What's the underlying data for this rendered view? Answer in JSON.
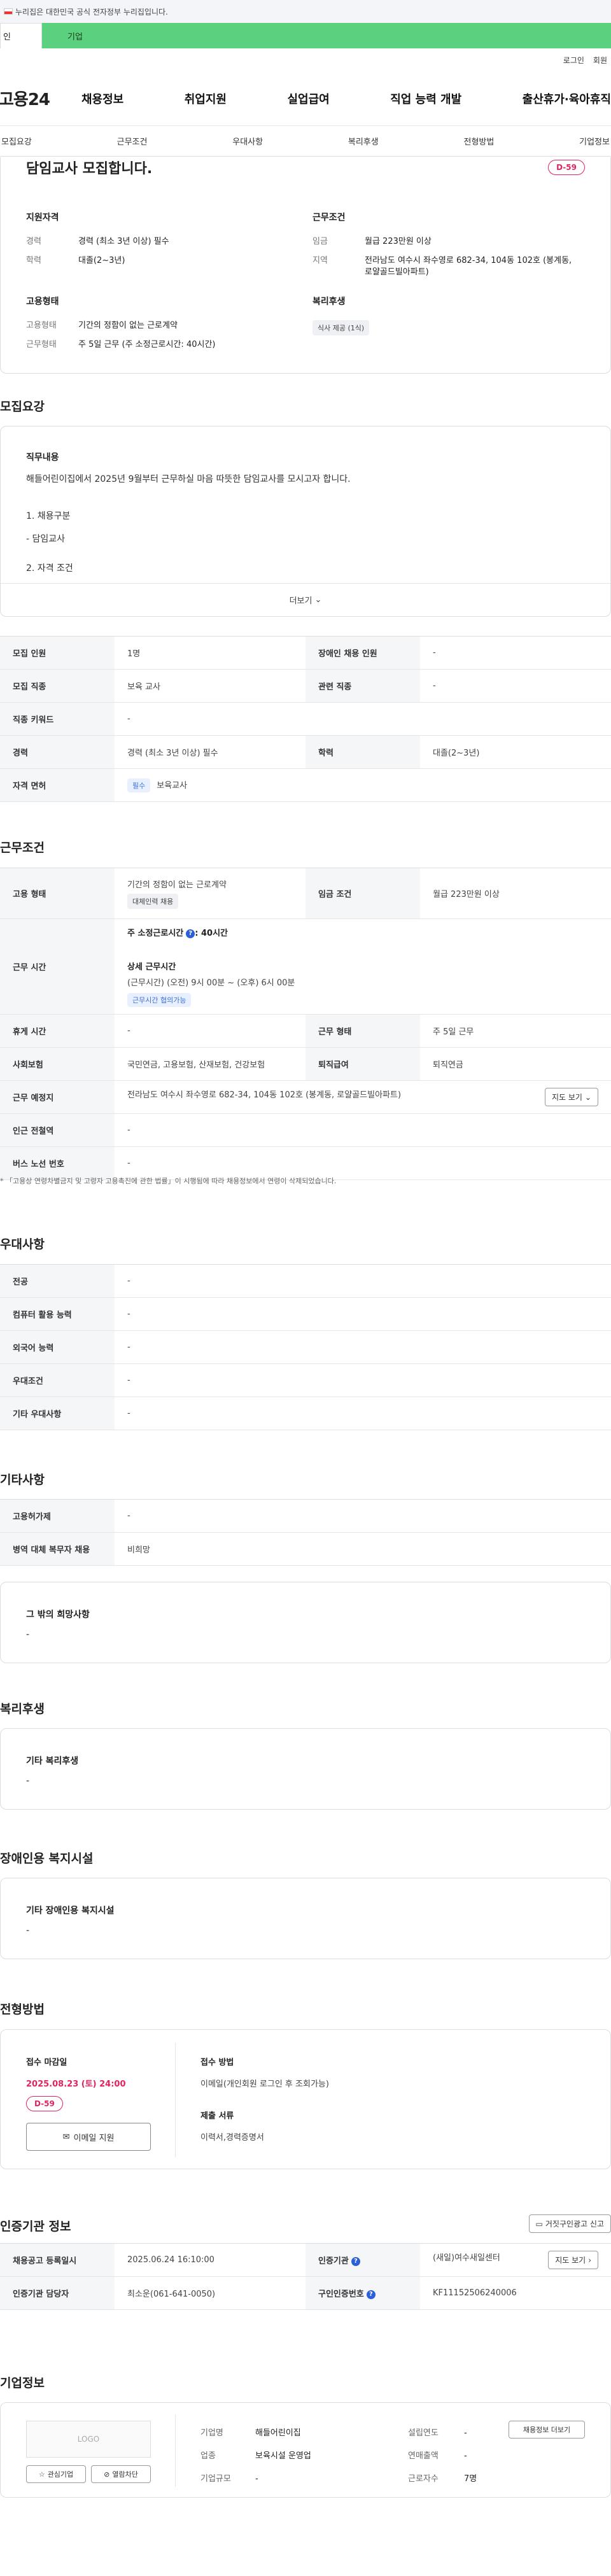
{
  "notice": {
    "text": "누리집은 대한민국 공식 전자정부 누리집입니다."
  },
  "tabs": {
    "personal": "인",
    "company": "기업"
  },
  "utility": {
    "login": "로그인",
    "join": "회원"
  },
  "gnb": {
    "logo": "고용24",
    "menu": [
      "채용정보",
      "취업지원",
      "실업급여",
      "직업 능력 개발",
      "출산휴가·육아휴직"
    ]
  },
  "subtabs": [
    "모집요강",
    "근무조건",
    "우대사항",
    "복리후생",
    "전형방법",
    "기업정보"
  ],
  "job": {
    "title": "담임교사 모집합니다.",
    "dday": "D-59",
    "support": {
      "heading": "지원자격",
      "rows": [
        {
          "k": "경력",
          "v": "경력 (최소 3년 이상) 필수"
        },
        {
          "k": "학력",
          "v": "대졸(2~3년)"
        }
      ]
    },
    "condition": {
      "heading": "근무조건",
      "rows": [
        {
          "k": "임금",
          "v": "월급 223만원 이상"
        },
        {
          "k": "지역",
          "v": "전라남도 여수시 좌수영로 682-34, 104동 102호 (봉계동, 로얄골드빌아파트)"
        }
      ]
    },
    "employ": {
      "heading": "고용형태",
      "rows": [
        {
          "k": "고용형태",
          "v": "기간의 정함이 없는 근로계약"
        },
        {
          "k": "근무형태",
          "v": "주 5일 근무 (주 소정근로시간: 40시간)"
        }
      ]
    },
    "welfare": {
      "heading": "복리후생",
      "chip": "식사 제공 (1식)"
    }
  },
  "recruit": {
    "title": "모집요강",
    "duty_heading": "직무내용",
    "duty_text": "해들어린이집에서 2025년 9월부터 근무하실 마음 따뜻한 담임교사를 모시고자 합니다.",
    "list1": "1. 채용구분",
    "bullet1": "- 담임교사",
    "list2": "2. 자격 조건",
    "more": "더보기",
    "rows": [
      {
        "k1": "모집 인원",
        "v1": "1명",
        "k2": "장애인 채용 인원",
        "v2": "-"
      },
      {
        "k1": "모집 직종",
        "v1": "보육 교사",
        "k2": "관련 직종",
        "v2": "-"
      },
      {
        "k1": "직종 키워드",
        "v1": "-"
      },
      {
        "k1": "경력",
        "v1": "경력 (최소 3년 이상) 필수",
        "k2": "학력",
        "v2": "대졸(2~3년)"
      }
    ],
    "license_label": "자격 면허",
    "license_badge": "필수",
    "license_value": "보육교사"
  },
  "work": {
    "title": "근무조건",
    "employ_label": "고용 형태",
    "employ_value": "기간의 정함이 없는 근로계약",
    "employ_chip": "대체인력 채용",
    "wage_label": "임금 조건",
    "wage_value": "월급 223만원 이상",
    "time_label": "근무 시간",
    "time_week": "주 소정근로시간",
    "time_hours": ": 40시간",
    "time_detail_h": "상세 근무시간",
    "time_detail": "(근무시간) (오전) 9시 00분 ~ (오후) 6시 00분",
    "time_chip": "근무시간 협의가능",
    "rest_label": "휴게 시간",
    "rest_value": "-",
    "form_label": "근무 형태",
    "form_value": "주 5일 근무",
    "ins_label": "사회보험",
    "ins_value": "국민연금, 고용보험, 산재보험, 건강보험",
    "retire_label": "퇴직급여",
    "retire_value": "퇴직연금",
    "place_label": "근무 예정지",
    "place_value": "전라남도 여수시 좌수영로 682-34, 104동 102호 (봉계동, 로얄골드빌아파트)",
    "map_btn": "지도 보기",
    "subway_label": "인근 전철역",
    "subway_value": "-",
    "bus_label": "버스 노선 번호",
    "bus_value": "-",
    "footnote": "「고용상 연령차별금지 및 고령자 고용촉진에 관한 법률」이 시행됨에 따라 채용정보에서 연령이 삭제되었습니다."
  },
  "pref": {
    "title": "우대사항",
    "rows": [
      {
        "k": "전공",
        "v": "-"
      },
      {
        "k": "컴퓨터 활용 능력",
        "v": "-"
      },
      {
        "k": "외국어 능력",
        "v": "-"
      },
      {
        "k": "우대조건",
        "v": "-"
      },
      {
        "k": "기타 우대사항",
        "v": "-"
      }
    ]
  },
  "etc": {
    "title": "기타사항",
    "rows": [
      {
        "k": "고용허가제",
        "v": "-"
      },
      {
        "k": "병역 대체 복무자 채용",
        "v": "비희망"
      }
    ],
    "box_h": "그 밖의 희망사항",
    "box_v": "-"
  },
  "welfare": {
    "title": "복리후생",
    "box_h": "기타 복리후생",
    "box_v": "-"
  },
  "disabled": {
    "title": "장애인용 복지시설",
    "box_h": "기타 장애인용 복지시설",
    "box_v": "-"
  },
  "process": {
    "title": "전형방법",
    "deadline_h": "접수 마감일",
    "deadline_v": "2025.08.23 (토) 24:00",
    "dday": "D-59",
    "email_btn": "이메일 지원",
    "method_h": "접수 방법",
    "method_v": "이메일(개인회원 로그인 후 조회가능)",
    "docs_h": "제출 서류",
    "docs_v": "이력서,경력증명서"
  },
  "cert": {
    "title": "인증기관 정보",
    "report_btn": "거짓구인광고 신고",
    "rows": [
      {
        "k1": "채용공고 등록일시",
        "v1": "2025.06.24 16:10:00",
        "k2": "인증기관",
        "v2": "(새일)여수새일센터",
        "btn": "지도 보기"
      },
      {
        "k1": "인증기관 담당자",
        "v1": "최소운(061-641-0050)",
        "k2": "구인인증번호",
        "v2": "KF11152506240006"
      }
    ]
  },
  "company": {
    "title": "기업정보",
    "logo": "LOGO",
    "interest": "관심기업",
    "block": "열람차단",
    "rows": [
      {
        "k1": "기업명",
        "v1": "해들어린이집",
        "k2": "설립연도",
        "v2": "-"
      },
      {
        "k1": "업종",
        "v1": "보육시설 운영업",
        "k2": "연매출액",
        "v2": "-"
      },
      {
        "k1": "기업규모",
        "v1": "-",
        "k2": "근로자수",
        "v2": "7명"
      }
    ],
    "recruit_btn": "채용정보 더보기"
  }
}
